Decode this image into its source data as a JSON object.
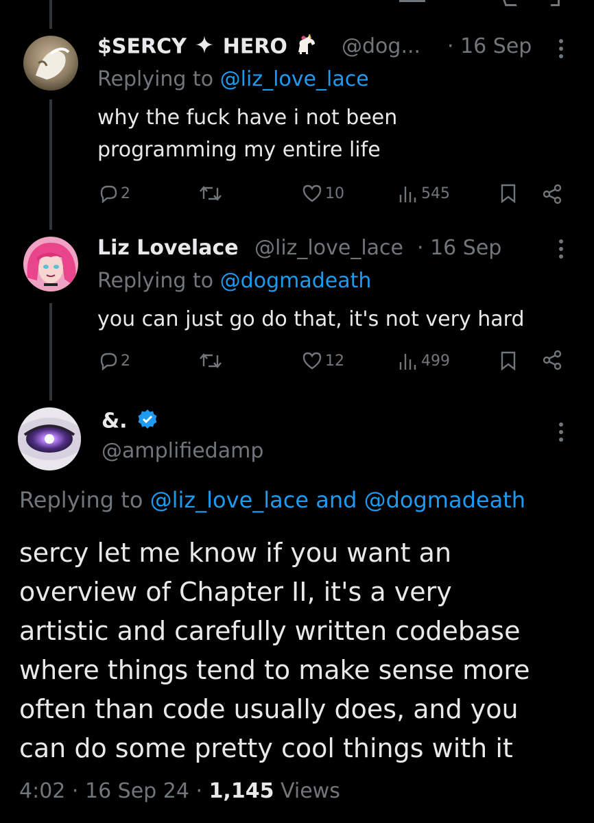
{
  "tweets": [
    {
      "name": "$SERCY",
      "name_suffix": "HERO",
      "handle": "@dog...",
      "time": "· 16 Sep",
      "replying_prefix": "Replying to ",
      "replying_mention": "@liz_love_lace",
      "text_lines": [
        "why the fuck have i not been",
        "programming my entire life"
      ],
      "replies": "2",
      "likes": "10",
      "views": "545"
    },
    {
      "name": "Liz Lovelace",
      "handle": "@liz_love_lace",
      "time": "· 16 Sep",
      "replying_prefix": "Replying to ",
      "replying_mention": "@dogmadeath",
      "text_lines": [
        "you can just go do that, it's not very hard"
      ],
      "replies": "2",
      "likes": "12",
      "views": "499"
    }
  ],
  "main": {
    "name": "&.",
    "handle": "@amplifiedamp",
    "replying_prefix": "Replying to ",
    "replying_mentions": "@liz_love_lace and @dogmadeath",
    "text_lines": [
      "sercy let me know if you want an",
      "overview of Chapter II, it's a very",
      "artistic and carefully written codebase",
      "where things tend to make sense more",
      "often than code usually does, and you",
      "can do some pretty cool things with it"
    ],
    "time": "4:02 · 16 Sep 24 · ",
    "views_count": "1,145",
    "views_label": " Views"
  },
  "colors": {
    "accent": "#1d9bf0",
    "muted": "#71767b",
    "text": "#e7e9ea",
    "background": "#000000"
  },
  "icons": [
    "reply-icon",
    "retweet-icon",
    "like-icon",
    "views-icon",
    "bookmark-icon",
    "share-icon",
    "more-icon",
    "verified-badge-icon",
    "unicorn-emoji-icon",
    "sparkle-icon"
  ]
}
